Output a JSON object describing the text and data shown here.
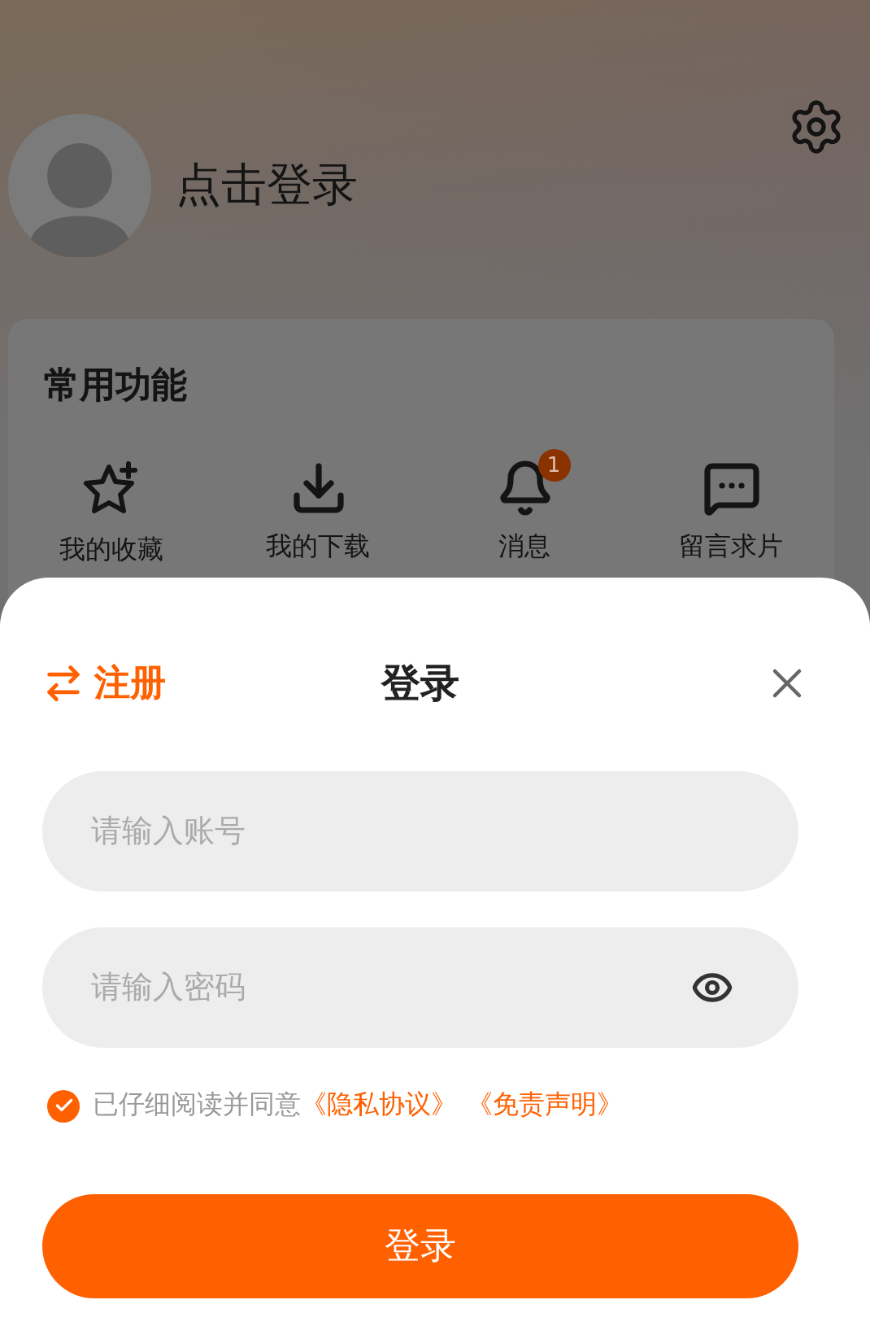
{
  "header": {
    "login_prompt": "点击登录"
  },
  "functions": {
    "title": "常用功能",
    "items": [
      {
        "kind": "favorites",
        "label": "我的收藏"
      },
      {
        "kind": "downloads",
        "label": "我的下载"
      },
      {
        "kind": "messages",
        "label": "消息",
        "badge": "1"
      },
      {
        "kind": "request",
        "label": "留言求片"
      }
    ]
  },
  "login_sheet": {
    "switch_label": "注册",
    "title": "登录",
    "fields": [
      {
        "kind": "account",
        "placeholder": "请输入账号"
      },
      {
        "kind": "password",
        "placeholder": "请输入密码"
      }
    ],
    "agreement": {
      "checked": true,
      "text": "已仔细阅读并同意",
      "links": [
        "《隐私协议》",
        "《免责声明》"
      ]
    },
    "submit": "登录"
  }
}
